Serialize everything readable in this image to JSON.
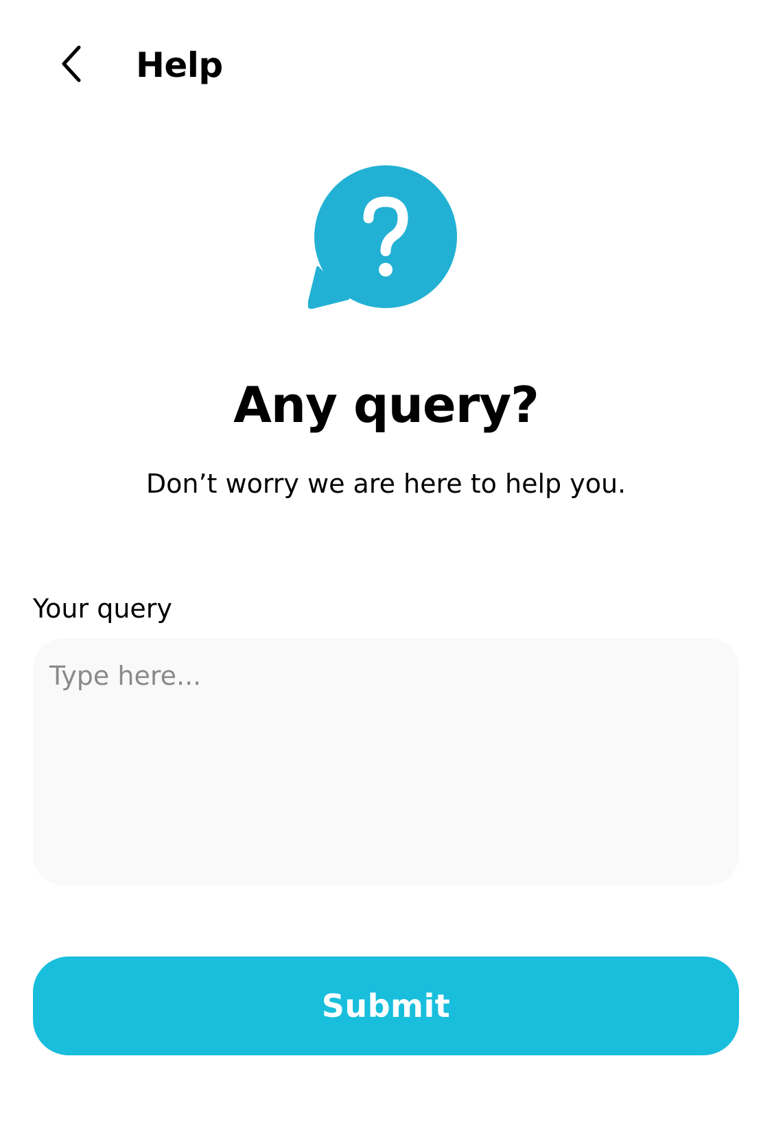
{
  "header": {
    "back_icon": "chevron-left-icon",
    "title": "Help"
  },
  "hero": {
    "icon": "question-speech-bubble-icon",
    "icon_color": "#22B1D4",
    "headline": "Any query?",
    "subtitle": "Don’t worry we are here to help you."
  },
  "form": {
    "query_label": "Your query",
    "query_value": "",
    "query_placeholder": "Type here...",
    "field_background": "#F9F9F9"
  },
  "actions": {
    "submit_label": "Submit",
    "submit_color": "#18BEDC"
  }
}
